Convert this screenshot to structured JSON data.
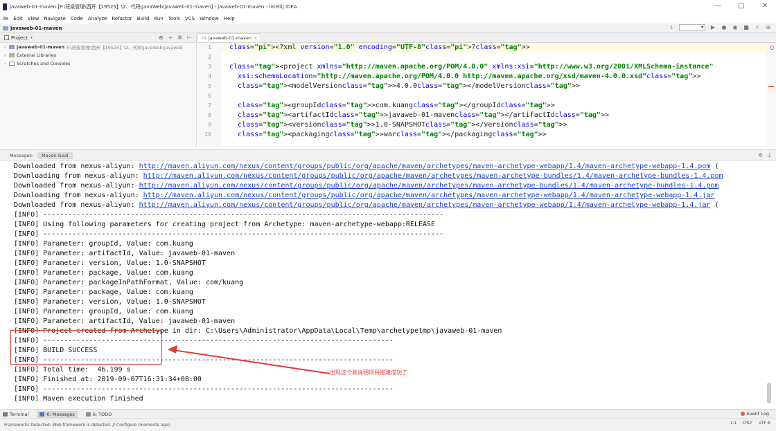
{
  "window": {
    "title": "javaweb-01-maven [F:\\班级管理\\西开【19525】\\2、代码\\JavaWeb\\javaweb-01-maven] - javaweb-01-maven - IntelliJ IDEA",
    "controls": [
      "—",
      "▢",
      "✕"
    ]
  },
  "menu": [
    "ile",
    "Edit",
    "View",
    "Navigate",
    "Code",
    "Analyze",
    "Refactor",
    "Build",
    "Run",
    "Tools",
    "VCS",
    "Window",
    "Help"
  ],
  "navbar": {
    "project": "javaweb-01-maven"
  },
  "project_panel": {
    "header": "Project",
    "tree": [
      {
        "name": "javaweb-01-maven",
        "path": "F:\\班级管理\\西开【19525】\\2、代码\\JavaWeb\\javaweb"
      },
      {
        "name": "External Libraries",
        "path": ""
      },
      {
        "name": "Scratches and Consoles",
        "path": ""
      }
    ]
  },
  "editor": {
    "tab": "javaweb-01-maven",
    "lines": [
      {
        "n": "1",
        "text": "<?xml version=\"1.0\" encoding=\"UTF-8\"?>"
      },
      {
        "n": "2",
        "text": ""
      },
      {
        "n": "3",
        "text": "<project xmlns=\"http://maven.apache.org/POM/4.0.0\" xmlns:xsi=\"http://www.w3.org/2001/XMLSchema-instance\""
      },
      {
        "n": "4",
        "text": "  xsi:schemaLocation=\"http://maven.apache.org/POM/4.0.0 http://maven.apache.org/xsd/maven-4.0.0.xsd\">"
      },
      {
        "n": "5",
        "text": "  <modelVersion>4.0.0</modelVersion>"
      },
      {
        "n": "6",
        "text": ""
      },
      {
        "n": "7",
        "text": "  <groupId>com.kuang</groupId>"
      },
      {
        "n": "8",
        "text": "  <artifactId>javaweb-01-maven</artifactId>"
      },
      {
        "n": "9",
        "text": "  <version>1.0-SNAPSHOT</version>"
      },
      {
        "n": "10",
        "text": "  <packaging>war</packaging>"
      }
    ]
  },
  "messages": {
    "label": "Messages:",
    "tab": "Maven Goal",
    "lines": [
      {
        "prefix": "Downloaded from nexus-aliyun: ",
        "link": "http://maven.aliyun.com/nexus/content/groups/public/org/apache/maven/archetypes/maven-archetype-webapp/1.4/maven-archetype-webapp-1.4.pom",
        "suffix": " ("
      },
      {
        "prefix": "Downloading from nexus-aliyun: ",
        "link": "http://maven.aliyun.com/nexus/content/groups/public/org/apache/maven/archetypes/maven-archetype-bundles/1.4/maven-archetype-bundles-1.4.pom",
        "suffix": ""
      },
      {
        "prefix": "Downloaded from nexus-aliyun: ",
        "link": "http://maven.aliyun.com/nexus/content/groups/public/org/apache/maven/archetypes/maven-archetype-bundles/1.4/maven-archetype-bundles-1.4.pom",
        "suffix": ""
      },
      {
        "prefix": "Downloading from nexus-aliyun: ",
        "link": "http://maven.aliyun.com/nexus/content/groups/public/org/apache/maven/archetypes/maven-archetype-webapp/1.4/maven-archetype-webapp-1.4.jar",
        "suffix": ""
      },
      {
        "prefix": "Downloaded from nexus-aliyun: ",
        "link": "http://maven.aliyun.com/nexus/content/groups/public/org/apache/maven/archetypes/maven-archetype-webapp/1.4/maven-archetype-webapp-1.4.jar",
        "suffix": " ("
      },
      {
        "prefix": "[INFO] ------------------------------------------------------------------------------------------------",
        "link": "",
        "suffix": ""
      },
      {
        "prefix": "[INFO] Using following parameters for creating project from Archetype: maven-archetype-webapp:RELEASE",
        "link": "",
        "suffix": ""
      },
      {
        "prefix": "[INFO] ------------------------------------------------------------------------------------------------",
        "link": "",
        "suffix": ""
      },
      {
        "prefix": "[INFO] Parameter: groupId, Value: com.kuang",
        "link": "",
        "suffix": ""
      },
      {
        "prefix": "[INFO] Parameter: artifactId, Value: javaweb-01-maven",
        "link": "",
        "suffix": ""
      },
      {
        "prefix": "[INFO] Parameter: version, Value: 1.0-SNAPSHOT",
        "link": "",
        "suffix": ""
      },
      {
        "prefix": "[INFO] Parameter: package, Value: com.kuang",
        "link": "",
        "suffix": ""
      },
      {
        "prefix": "[INFO] Parameter: packageInPathFormat, Value: com/kuang",
        "link": "",
        "suffix": ""
      },
      {
        "prefix": "[INFO] Parameter: package, Value: com.kuang",
        "link": "",
        "suffix": ""
      },
      {
        "prefix": "[INFO] Parameter: version, Value: 1.0-SNAPSHOT",
        "link": "",
        "suffix": ""
      },
      {
        "prefix": "[INFO] Parameter: groupId, Value: com.kuang",
        "link": "",
        "suffix": ""
      },
      {
        "prefix": "[INFO] Parameter: artifactId, Value: javaweb-01-maven",
        "link": "",
        "suffix": ""
      },
      {
        "prefix": "[INFO] Project created from Archetype in dir: C:\\Users\\Administrator\\AppData\\Local\\Temp\\archetypetmp\\javaweb-01-maven",
        "link": "",
        "suffix": ""
      },
      {
        "prefix": "[INFO] ------------------------------------------------------------------------------------",
        "link": "",
        "suffix": ""
      },
      {
        "prefix": "[INFO] BUILD SUCCESS",
        "link": "",
        "suffix": ""
      },
      {
        "prefix": "[INFO] ------------------------------------------------------------------------------------",
        "link": "",
        "suffix": ""
      },
      {
        "prefix": "[INFO] Total time:  46.199 s",
        "link": "",
        "suffix": ""
      },
      {
        "prefix": "[INFO] Finished at: 2019-09-07T16:31:34+08:00",
        "link": "",
        "suffix": ""
      },
      {
        "prefix": "[INFO] ------------------------------------------------------------------------------------",
        "link": "",
        "suffix": ""
      },
      {
        "prefix": "[INFO] Maven execution finished",
        "link": "",
        "suffix": ""
      }
    ]
  },
  "annotation": {
    "text": "出现这个就说明项目搭建成功了",
    "color": "#e53935"
  },
  "bottom_tabs": [
    "Terminal",
    "0: Messages",
    "6: TODO"
  ],
  "event_log": "Event Log",
  "status": {
    "left": "Frameworks Detected: Web framework is detected. // Configure (moments ago)",
    "right": [
      "1:1",
      "CRLF",
      "UTF-8"
    ]
  }
}
